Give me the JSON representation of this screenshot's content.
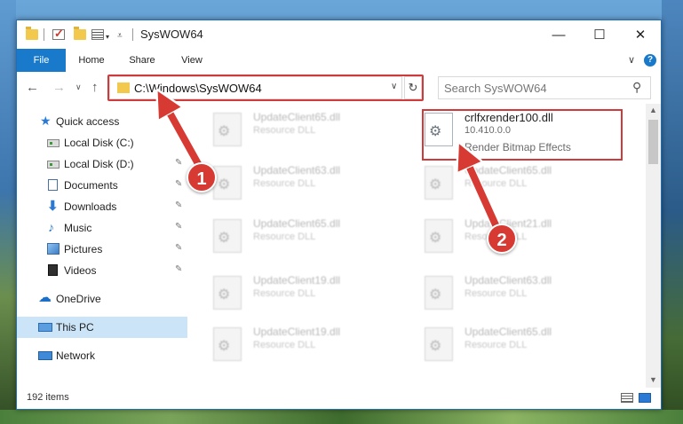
{
  "window": {
    "title": "SysWOW64",
    "minimize_glyph": "—",
    "maximize_glyph": "☐",
    "close_glyph": "✕"
  },
  "ribbon": {
    "tabs": [
      "File",
      "Home",
      "Share",
      "View"
    ],
    "expand_glyph": "∨",
    "help_glyph": "?"
  },
  "navigation": {
    "back_glyph": "←",
    "forward_glyph": "→",
    "recent_glyph": "∨",
    "up_glyph": "↑",
    "address": "C:\\Windows\\SysWOW64",
    "address_dropdown_glyph": "∨",
    "refresh_glyph": "↻",
    "search_placeholder": "Search SysWOW64",
    "search_glyph": "⚲"
  },
  "sidebar": {
    "items": [
      {
        "label": "Quick access",
        "icon": "star-icon",
        "pinned": false
      },
      {
        "label": "Local Disk (C:)",
        "icon": "disk-icon",
        "pinned": true
      },
      {
        "label": "Local Disk (D:)",
        "icon": "disk-icon",
        "pinned": true
      },
      {
        "label": "Documents",
        "icon": "documents-icon",
        "pinned": true
      },
      {
        "label": "Downloads",
        "icon": "downloads-icon",
        "pinned": true
      },
      {
        "label": "Music",
        "icon": "music-icon",
        "pinned": true
      },
      {
        "label": "Pictures",
        "icon": "pictures-icon",
        "pinned": true
      },
      {
        "label": "Videos",
        "icon": "videos-icon",
        "pinned": true
      },
      {
        "label": "OneDrive",
        "icon": "onedrive-icon",
        "pinned": false
      },
      {
        "label": "This PC",
        "icon": "this-pc-icon",
        "pinned": false,
        "selected": true
      },
      {
        "label": "Network",
        "icon": "network-icon",
        "pinned": false
      }
    ],
    "pin_glyph": "📌"
  },
  "files": {
    "left_column": [
      {
        "name": "UpdateClient65.dll",
        "type": "Resource DLL"
      },
      {
        "name": "UpdateClient63.dll",
        "type": "Resource DLL"
      },
      {
        "name": "UpdateClient65.dll",
        "type": "Resource DLL"
      },
      {
        "name": "UpdateClient19.dll",
        "type": "Resource DLL"
      },
      {
        "name": "UpdateClient19.dll",
        "type": "Resource DLL"
      }
    ],
    "right_column": [
      {
        "name": "crlfxrender100.dll",
        "type": "10.410.0.0",
        "description": "Render Bitmap Effects",
        "highlighted": true
      },
      {
        "name": "UpdateClient65.dll",
        "type": "Resource DLL"
      },
      {
        "name": "UpdateClient21.dll",
        "type": "Resource DLL"
      },
      {
        "name": "UpdateClient63.dll",
        "type": "Resource DLL"
      },
      {
        "name": "UpdateClient65.dll",
        "type": "Resource DLL"
      }
    ]
  },
  "status_bar": {
    "item_count": "192 items"
  },
  "annotations": {
    "step1": "1",
    "step2": "2",
    "color": "#d63a32"
  }
}
